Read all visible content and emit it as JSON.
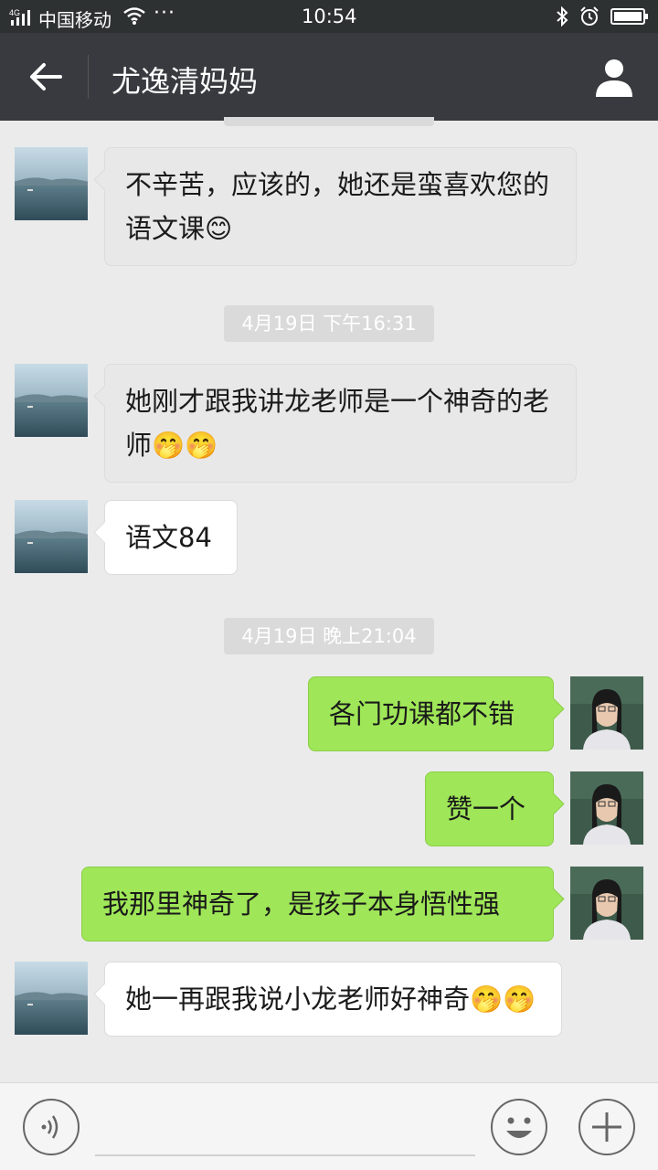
{
  "status_bar": {
    "network": "4G",
    "carrier": "中国移动",
    "more": "···",
    "time": "10:54"
  },
  "header": {
    "title": "尤逸清妈妈"
  },
  "messages": [
    {
      "side": "left",
      "text": "不辛苦，应该的，她还是蛮喜欢您的语文课😊"
    },
    {
      "timestamp": "4月19日 下午16:31"
    },
    {
      "side": "left",
      "text": "她刚才跟我讲龙老师是一个神奇的老师🤭🤭"
    },
    {
      "side": "left",
      "text": "语文84"
    },
    {
      "timestamp": "4月19日 晚上21:04"
    },
    {
      "side": "right",
      "text": "各门功课都不错"
    },
    {
      "side": "right",
      "text": "赞一个"
    },
    {
      "side": "right",
      "text": "我那里神奇了，是孩子本身悟性强"
    },
    {
      "side": "left",
      "text": "她一再跟我说小龙老师好神奇🤭🤭"
    }
  ],
  "input_bar": {
    "placeholder": "",
    "icons": [
      "voice-icon",
      "emoji-icon",
      "plus-icon"
    ]
  },
  "colors": {
    "header_bg": "#393a3f",
    "status_bg": "#2e3132",
    "chat_bg": "#ebebeb",
    "bubble_self": "#9fe658",
    "bubble_other": "#ffffff"
  }
}
